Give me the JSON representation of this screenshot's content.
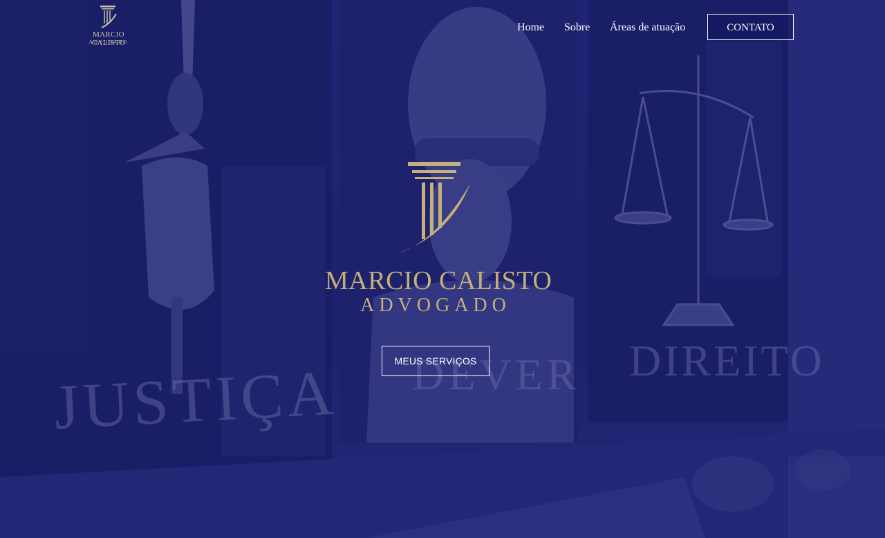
{
  "header": {
    "logo_name": "MARCIO CALISTO",
    "logo_sub": "ADVOGADO"
  },
  "nav": {
    "items": [
      {
        "label": "Home"
      },
      {
        "label": "Sobre"
      },
      {
        "label": "Áreas de atuação"
      }
    ],
    "cta_label": "CONTATO"
  },
  "hero": {
    "name": "MARCIO CALISTO",
    "subtitle": "ADVOGADO",
    "button_label": "MEUS SERVIÇOS",
    "background_words": [
      "JUSTIÇA",
      "DEVER",
      "DIREITO"
    ]
  },
  "colors": {
    "brand_navy": "#1b1f6b",
    "gold": "#c4b07a",
    "white": "#ffffff"
  },
  "icons": {
    "logo": "column-pillar-icon",
    "bg_left": "sword-icon",
    "bg_right": "scales-of-justice-icon"
  }
}
